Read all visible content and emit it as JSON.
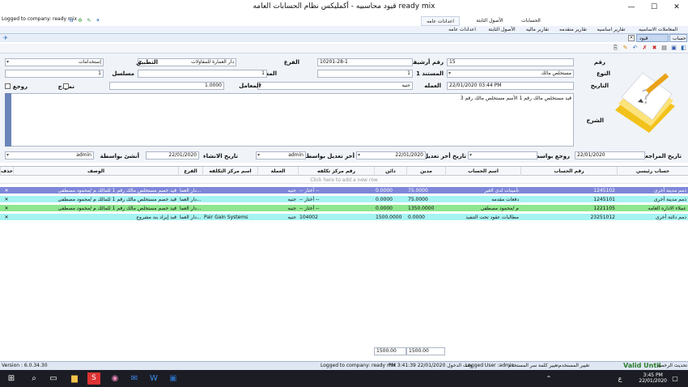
{
  "window": {
    "title": "قيود محاسبيه - أكمليكس نظام الحسابات العامه ready mix",
    "minimize": "—",
    "maximize": "☐",
    "close": "✕"
  },
  "ribbon": {
    "logged_to": "Logged to company: ready mix",
    "tabs": [
      "المعاملات الاساسيه",
      "تقارير اساسيه",
      "تقارير متقدمه",
      "تقارير ماليه",
      "الأصول الثابتة",
      "اعدادات عامه"
    ],
    "top_tabs": [
      "الحسابات",
      "الأصول الثابتة",
      "اعدادات عامه"
    ]
  },
  "doc_tab": {
    "label": "قيود محاسبيه",
    "side_label": "حساب"
  },
  "form": {
    "labels": {
      "number": "رقم",
      "type": "النوع",
      "date": "التاريخ",
      "explanation": "الشرح",
      "archive_number": "رقم أرشيف",
      "document1": "المستند 1",
      "currency": "العمله",
      "branch": "الفرع",
      "document2": "المستند 2",
      "rate": "المعامل",
      "application": "التطبيق",
      "serial": "مسلسل",
      "template": "نموذج",
      "reversal": "روجع",
      "review_date": "تاريخ المراجعة",
      "reviewed_by": "روجع بواسطة",
      "last_mod_date": "تاريخ أخر تعديل",
      "last_mod_by": "أخر تعديل بواسطة",
      "created_date": "تاريخ الانشاء",
      "created_by": "أنشئ بواسطة"
    },
    "values": {
      "number": "15",
      "type": "مستخلص مالك",
      "date": "22/01/2020 03:44 PM",
      "archive_number": "10201-28-1",
      "document1": "1",
      "currency": "جنيه",
      "branch": "دار العمارة للمقاولات",
      "document2": "1",
      "rate": "1.0000",
      "application": "إستخدامات",
      "serial": "1",
      "explanation": "قيد مستخلص مالك رقم 1 الأسم مستخلص مالك رقم 3",
      "review_date": "22/01/2020",
      "reviewed_by": "",
      "last_mod_date": "22/01/2020",
      "last_mod_by": "admin",
      "created_date": "22/01/2020",
      "created_by": "admin"
    }
  },
  "grid": {
    "columns": [
      "حساب رئيسي",
      "رقم الحساب",
      "اسم الحساب",
      "مدين",
      "دائن",
      "رقم مركز تكلفه",
      "العملة",
      "اسم مركز التكلفه",
      "الفرع",
      "الوصف",
      "حذف"
    ],
    "new_row_hint": "Click here to add a new row",
    "rows": [
      {
        "main": "ذمم مدينة أخرى",
        "acc_no": "1245102",
        "acc_name": "تأمينات لدى الغير",
        "debit": "75.0000",
        "credit": "0.0000",
        "cc_no": "-- أختار --",
        "currency": "جنيه",
        "cc_name": "",
        "branch": "دار العما...",
        "desc": "قيد خصم مستخلص مالك رقم 1 للمالك م /محمود مصطفى",
        "del": "✕",
        "color": "#7e87d8",
        "text": "#fff"
      },
      {
        "main": "ذمم مدينة أخرى",
        "acc_no": "1245101",
        "acc_name": "دفعات مقدمه",
        "debit": "75.0000",
        "credit": "0.0000",
        "cc_no": "-- أختار --",
        "currency": "جنيه",
        "cc_name": "",
        "branch": "دار العما...",
        "desc": "قيد خصم مستخلص مالك رقم 1 للمالك م /محمود مصطفى",
        "del": "✕",
        "color": "#a6f3f1",
        "text": "#111"
      },
      {
        "main": "عملاء الاداره العامه",
        "acc_no": "1221105",
        "acc_name": "م /محمود مصطفى",
        "debit": "1350.0000",
        "credit": "0.0000",
        "cc_no": "-- أختار --",
        "currency": "جنيه",
        "cc_name": "",
        "branch": "دار العما...",
        "desc": "قيد خصم مستخلص مالك رقم 1 للمالك م /محمود مصطفى",
        "del": "✕",
        "color": "#8ee68e",
        "text": "#111"
      },
      {
        "main": "ذمم دائنة أخرى",
        "acc_no": "23251012",
        "acc_name": "مطالبات عقود تحت التنفيذ",
        "debit": "0.0000",
        "credit": "1500.0000",
        "cc_no": "104002",
        "currency": "جنيه",
        "cc_name": "Pair Gain Systems",
        "branch": "دار العما...",
        "desc": "قيد إيراد بند مشروع",
        "del": "✕",
        "color": "#a6f3f1",
        "text": "#111"
      }
    ],
    "totals": {
      "debit": "1500.00",
      "credit": "1500.00"
    }
  },
  "status": {
    "version": "Version : 6.0.34.30",
    "items": [
      "Logged to company: ready mix",
      "PM 3:41:39 22/01/2020 وقت الدخول",
      "Logged User :admin",
      "تغيير كلمة سر المستخدم",
      "تغيير المستخدم",
      "Valid Until",
      "تحديث الرخصة"
    ]
  },
  "taskbar": {
    "time": "3:45 PM",
    "date": "22/01/2020",
    "lang": "ع"
  }
}
